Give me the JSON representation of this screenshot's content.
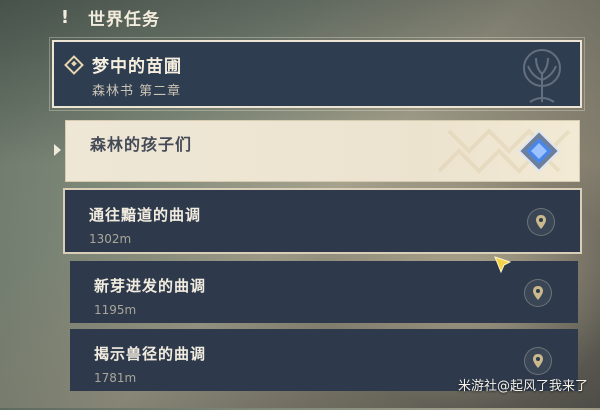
{
  "header": {
    "title": "世界任务",
    "icon": "exclamation-icon"
  },
  "quest": {
    "title": "梦中的苗圃",
    "subtitle": "森林书 第二章",
    "icon": "diamond-icon",
    "emblem": "tree-emblem"
  },
  "active_step": {
    "title": "森林的孩子们",
    "icon": "blue-gem-icon"
  },
  "steps": [
    {
      "title": "通往黯道的曲调",
      "distance": "1302m",
      "icon": "map-pin-icon"
    },
    {
      "title": "新芽进发的曲调",
      "distance": "1195m",
      "icon": "map-pin-icon"
    },
    {
      "title": "揭示兽径的曲调",
      "distance": "1781m",
      "icon": "map-pin-icon"
    }
  ],
  "watermark": "米游社@起风了我来了",
  "colors": {
    "card_dark": "#2e3a4c",
    "card_light": "#efe7d6",
    "border_light": "#ece5d3",
    "gem_blue": "#4a86e8",
    "gold": "#e6c46a"
  }
}
